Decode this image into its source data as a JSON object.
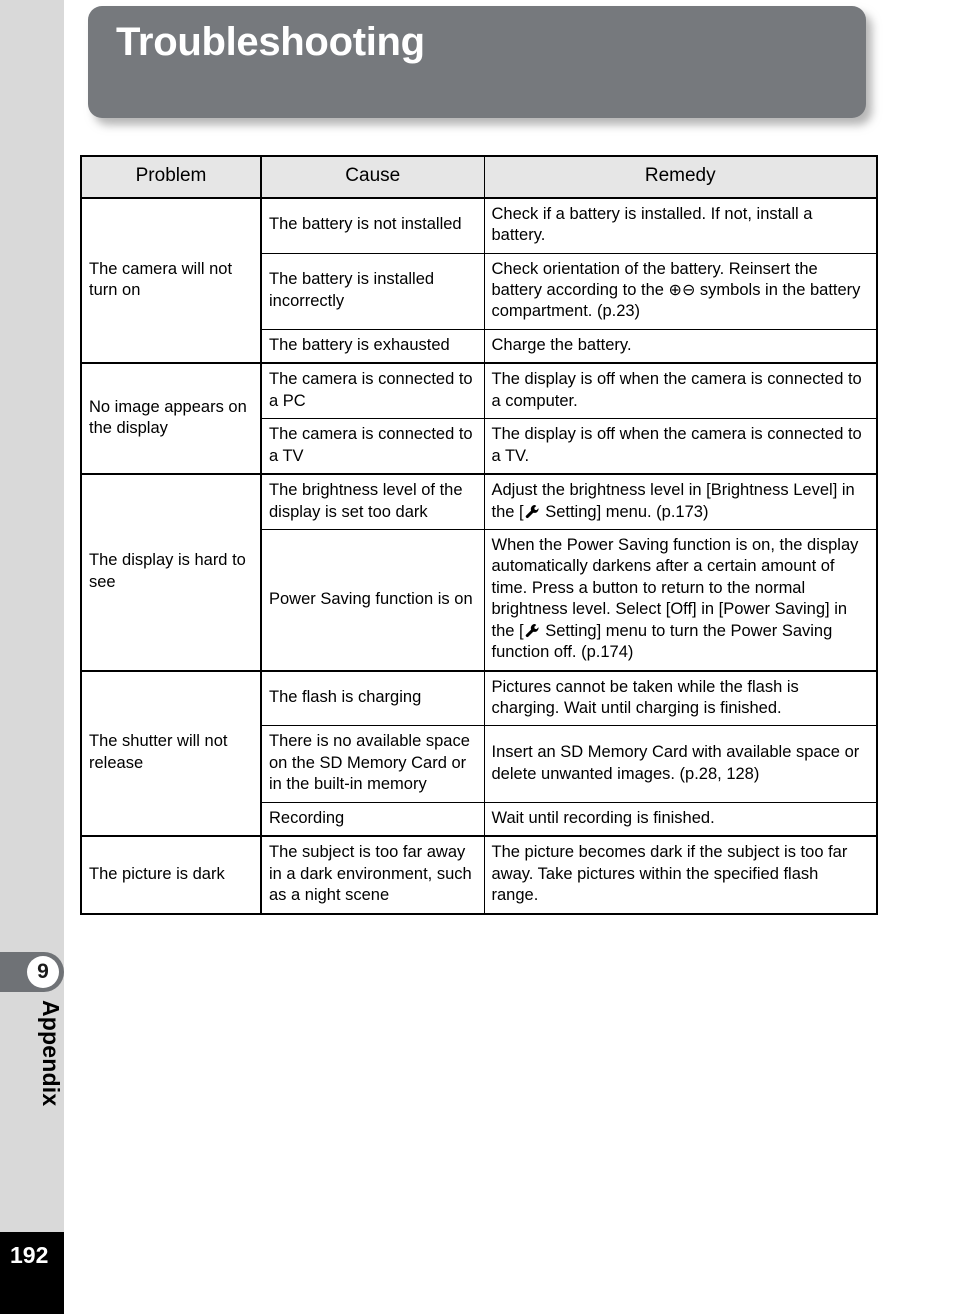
{
  "header": {
    "title": "Troubleshooting",
    "banner_color": "#76797d"
  },
  "sidebar": {
    "chapter_number": "9",
    "chapter_name": "Appendix",
    "page_number": "192",
    "rail_color": "#d9d9d9",
    "tab_color": "#6f7276"
  },
  "table": {
    "headers": {
      "problem": "Problem",
      "cause": "Cause",
      "remedy": "Remedy"
    },
    "groups": [
      {
        "problem": "The camera will not turn on",
        "rows": [
          {
            "cause": "The battery is not installed",
            "remedy": "Check if a battery is installed. If not, install a battery."
          },
          {
            "cause": "The battery is installed incorrectly",
            "remedy_pre": "Check orientation of the battery. Reinsert the battery according to the ",
            "remedy_sym_plus": "⊕",
            "remedy_sym_minus": "⊖",
            "remedy_post": " symbols in the battery compartment. (p.23)"
          },
          {
            "cause": "The battery is exhausted",
            "remedy": "Charge the battery."
          }
        ]
      },
      {
        "problem": "No image appears on the display",
        "rows": [
          {
            "cause": "The camera is connected to a PC",
            "remedy": "The display is off when the camera is connected to a computer."
          },
          {
            "cause": "The camera is connected to a TV",
            "remedy": "The display is off when the camera is connected to a TV."
          }
        ]
      },
      {
        "problem": "The display is hard to see",
        "rows": [
          {
            "cause": "The brightness level of the display is set too dark",
            "remedy_pre": "Adjust the brightness level in [Brightness Level] in the [",
            "remedy_post": " Setting] menu. (p.173)"
          },
          {
            "cause": "Power Saving function is on",
            "remedy_pre": "When the Power Saving function is on, the display automatically darkens after a certain amount of time. Press a button to return to the normal brightness level. Select [Off] in [Power Saving] in the [",
            "remedy_post": " Setting] menu to turn the Power Saving function off. (p.174)"
          }
        ]
      },
      {
        "problem": "The shutter will not release",
        "rows": [
          {
            "cause": "The flash is charging",
            "remedy": "Pictures cannot be taken while the flash is charging. Wait until charging is finished."
          },
          {
            "cause": "There is no available space on the SD Memory Card or in the built-in memory",
            "remedy": "Insert an SD Memory Card with available space or delete unwanted images. (p.28, 128)"
          },
          {
            "cause": "Recording",
            "remedy": "Wait until recording is finished."
          }
        ]
      },
      {
        "problem": "The picture is dark",
        "rows": [
          {
            "cause": "The subject is too far away in a dark environment, such as a night scene",
            "remedy": "The picture becomes dark if the subject is too far away. Take pictures within the specified flash range."
          }
        ]
      }
    ]
  },
  "icons": {
    "wrench": "wrench-icon"
  }
}
